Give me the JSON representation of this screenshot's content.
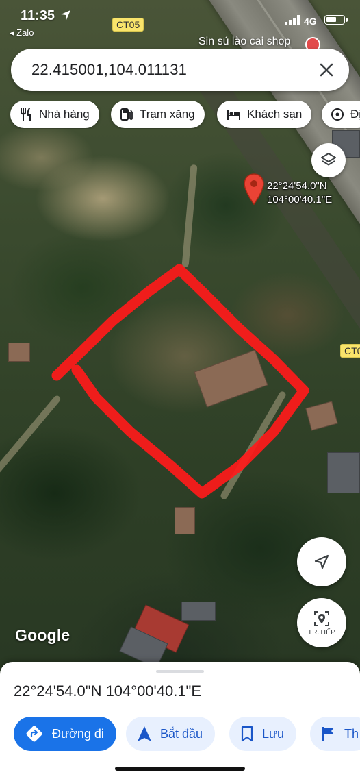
{
  "status_bar": {
    "time": "11:35",
    "back_app": "◂ Zalo",
    "network": "4G"
  },
  "map": {
    "road_labels": [
      "CT05",
      "CT0"
    ],
    "place_label": "Sin sú lào cai shop",
    "pin_label_line1": "22°24'54.0\"N",
    "pin_label_line2": "104°00'40.1\"E",
    "attribution": "Google",
    "live_view_label": "TR.TIẾP"
  },
  "search": {
    "query": "22.415001,104.011131"
  },
  "chips": [
    {
      "label": "Nhà hàng",
      "icon": "restaurant-icon"
    },
    {
      "label": "Trạm xăng",
      "icon": "gas-station-icon"
    },
    {
      "label": "Khách sạn",
      "icon": "hotel-icon"
    },
    {
      "label": "Đị",
      "icon": "attraction-icon"
    }
  ],
  "sheet": {
    "coordinates": "22°24'54.0\"N 104°00'40.1\"E",
    "actions": [
      {
        "label": "Đường đi",
        "icon": "directions-icon"
      },
      {
        "label": "Bắt đầu",
        "icon": "navigation-arrow-icon"
      },
      {
        "label": "Lưu",
        "icon": "bookmark-icon"
      },
      {
        "label": "Th",
        "icon": "flag-icon"
      }
    ]
  },
  "colors": {
    "accent": "#1a73e8",
    "accent_light": "#e8f0fe",
    "pin_red": "#ea4335",
    "parcel_outline": "#ff1a1a",
    "road_label_bg": "#f9e46b"
  }
}
